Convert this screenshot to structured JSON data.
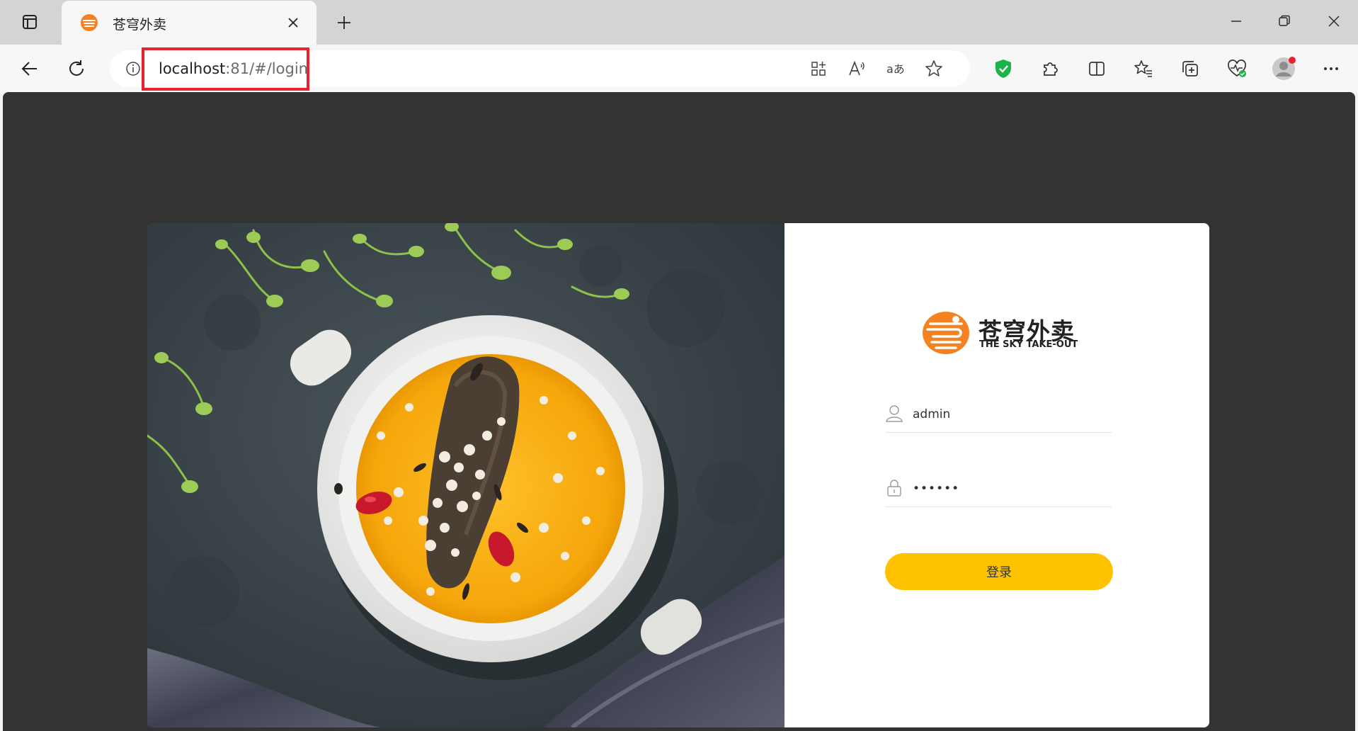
{
  "browser": {
    "tab": {
      "title": "苍穹外卖",
      "favicon": "sky-takeout-favicon"
    },
    "address_bar": {
      "host": "localhost",
      "rest": ":81/#/login"
    },
    "icons": [
      "workspaces-icon",
      "close-icon",
      "plus-icon",
      "minimize-icon",
      "restore-icon",
      "window-close-icon",
      "back-arrow-icon",
      "refresh-icon",
      "info-icon",
      "app-grid-icon",
      "read-aloud-icon",
      "translate-icon",
      "star-icon",
      "shield-extension-icon",
      "extensions-icon",
      "split-screen-icon",
      "favorites-icon",
      "collections-icon",
      "browser-essentials-icon",
      "profile-avatar-icon",
      "more-icon"
    ],
    "highlight_color": "#e8232f"
  },
  "login": {
    "brand": {
      "name_cn": "苍穹外卖",
      "name_en": "THE SKY TAKE-OUT",
      "color": "#f58220"
    },
    "username": {
      "value": "admin",
      "icon": "user-icon"
    },
    "password": {
      "value": "••••••",
      "icon": "lock-icon"
    },
    "submit_label": "登录",
    "accent_color": "#ffc200"
  }
}
